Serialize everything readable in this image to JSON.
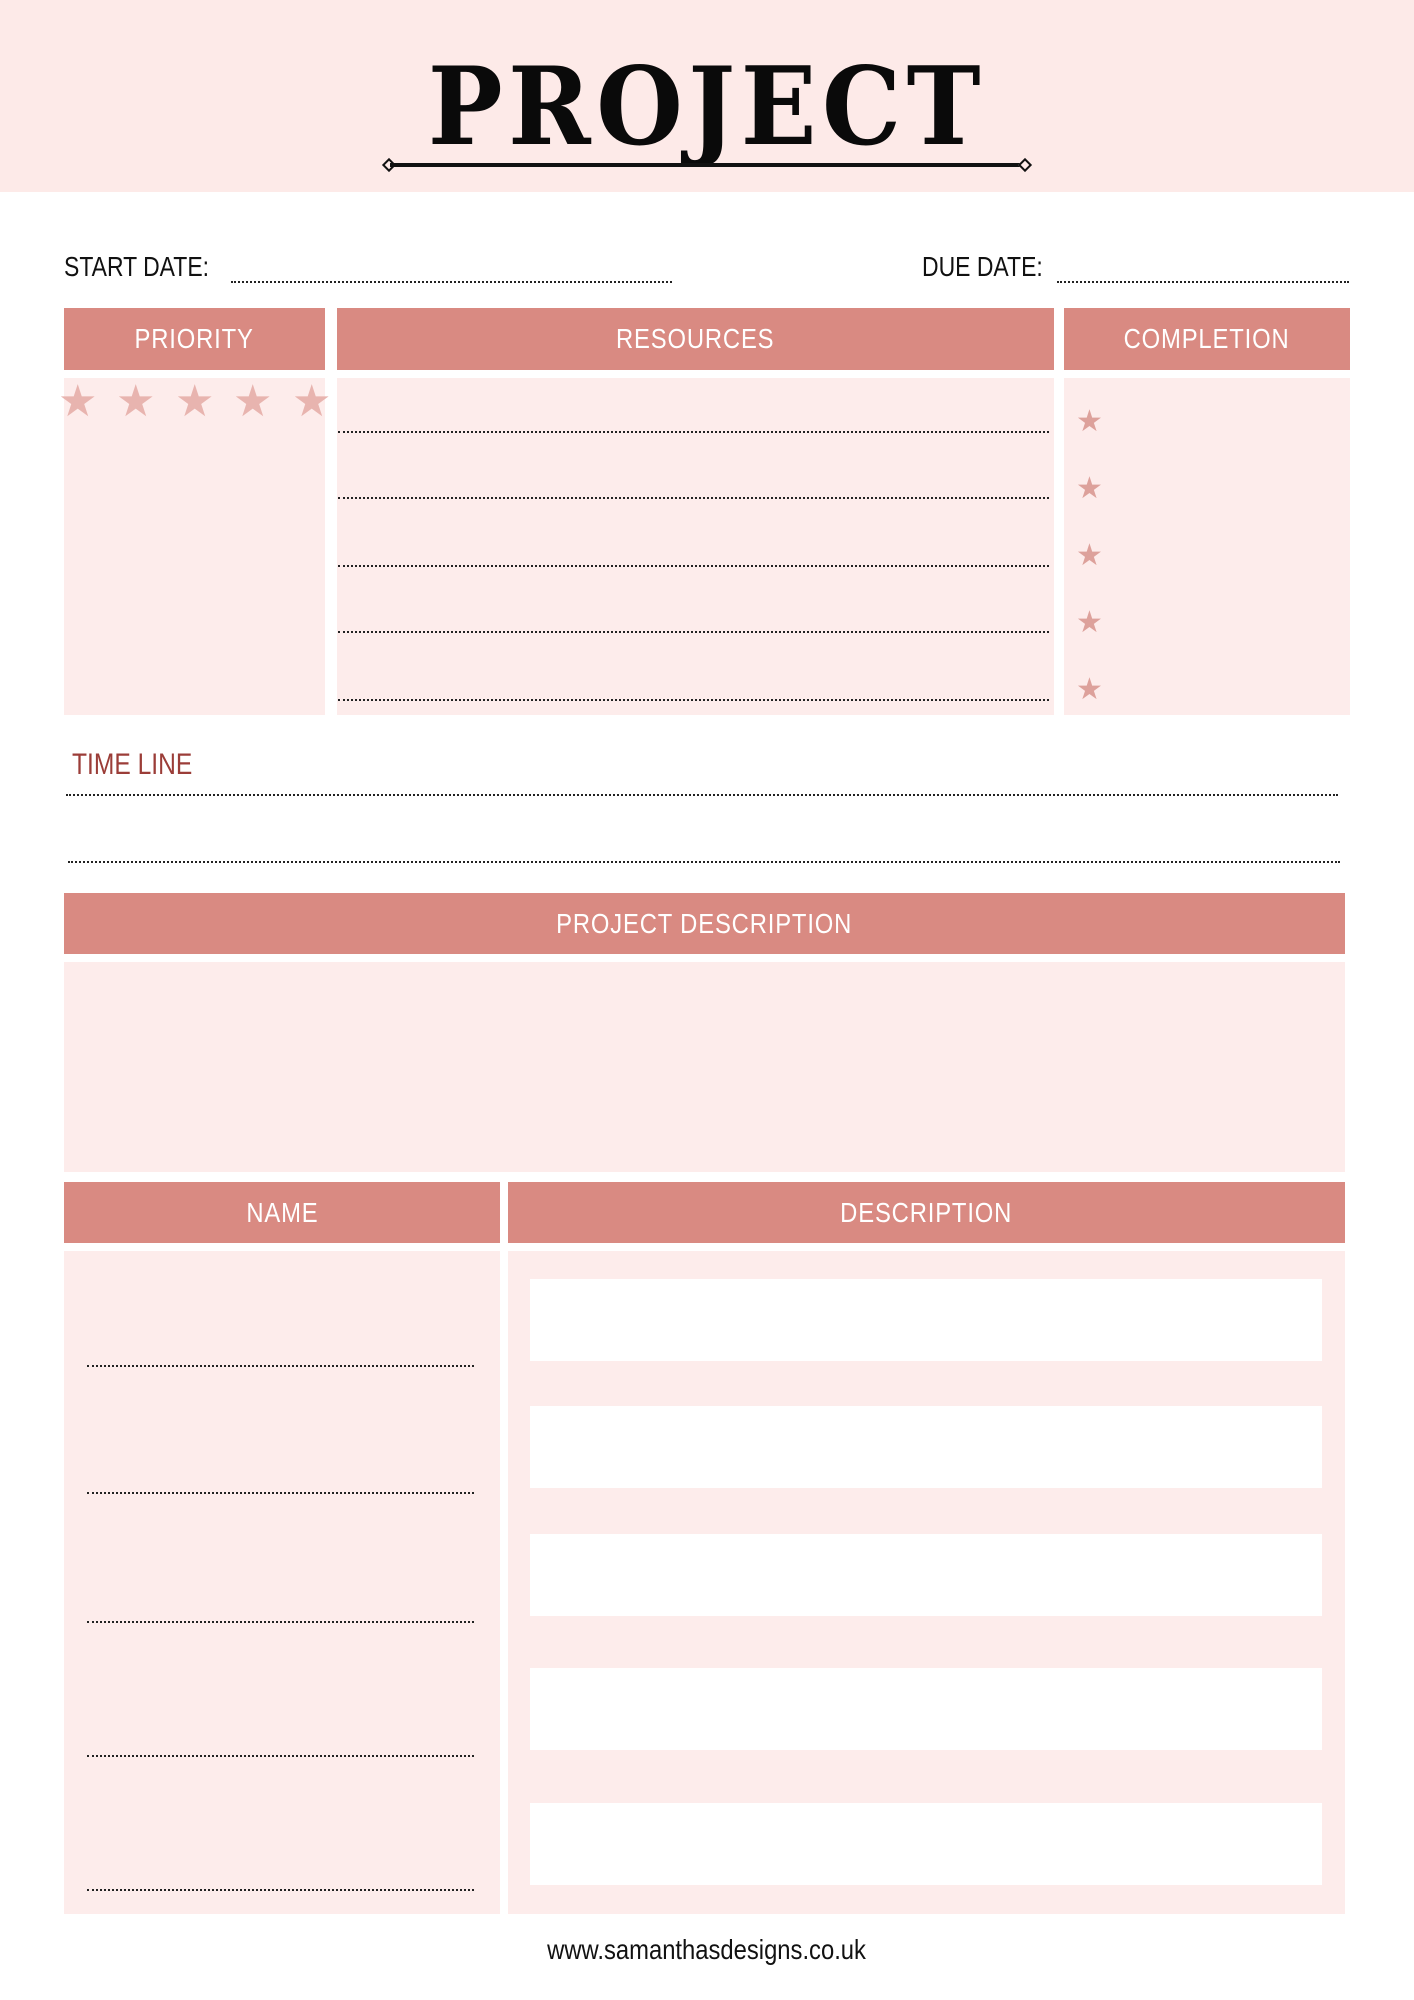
{
  "header": {
    "title": "PROJECT"
  },
  "dates": {
    "start_label": "START DATE:",
    "start_value": "",
    "due_label": "DUE DATE:",
    "due_value": ""
  },
  "sections": {
    "priority": {
      "label": "PRIORITY",
      "stars_total": 5,
      "stars_filled": 0
    },
    "resources": {
      "label": "RESOURCES",
      "lines": [
        "",
        "",
        "",
        "",
        ""
      ]
    },
    "completion": {
      "label": "COMPLETION",
      "items": [
        "",
        "",
        "",
        "",
        ""
      ]
    },
    "timeline": {
      "label": "TIME LINE",
      "lines": [
        "",
        ""
      ]
    },
    "project_description": {
      "label": "PROJECT DESCRIPTION",
      "value": ""
    },
    "name": {
      "label": "NAME",
      "entries": [
        "",
        "",
        "",
        "",
        ""
      ]
    },
    "description": {
      "label": "DESCRIPTION",
      "entries": [
        "",
        "",
        "",
        "",
        ""
      ]
    }
  },
  "icons": {
    "star": "★"
  },
  "colors": {
    "header_bg": "#d98a82",
    "panel_bg": "#fdeceb",
    "band_bg": "#fdeae8",
    "star": "#e8b4af",
    "timeline_text": "#9b3d38"
  },
  "footer": {
    "website": "www.samanthasdesigns.co.uk"
  }
}
